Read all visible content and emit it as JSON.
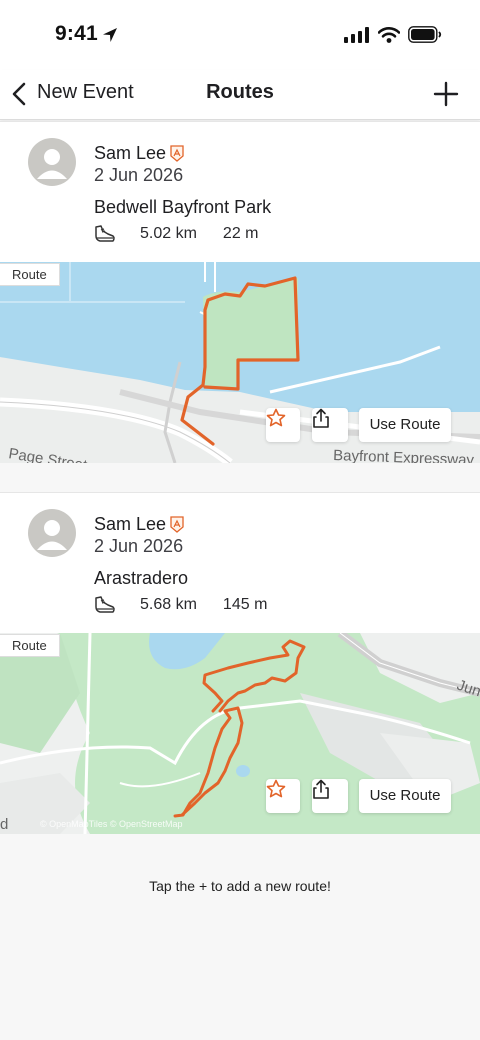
{
  "status_bar": {
    "time": "9:41"
  },
  "nav": {
    "back_label": "New Event",
    "title": "Routes"
  },
  "routes": [
    {
      "athlete": "Sam Lee",
      "date": "2 Jun 2026",
      "name": "Bedwell Bayfront Park",
      "distance": "5.02 km",
      "elevation": "22 m",
      "tag": "Route",
      "use_label": "Use Route",
      "map_labels": [
        "Page Street",
        "Bayfront Expressway"
      ],
      "attribution": ""
    },
    {
      "athlete": "Sam Lee",
      "date": "2 Jun 2026",
      "name": "Arastradero",
      "distance": "5.68 km",
      "elevation": "145 m",
      "tag": "Route",
      "use_label": "Use Route",
      "map_labels": [
        "Jun",
        "d"
      ],
      "attribution": "© OpenMapTiles © OpenStreetMap"
    }
  ],
  "footer_hint": "Tap the + to add a new route!",
  "colors": {
    "accent": "#e2642a",
    "water": "#aad8ef",
    "park": "#bfe5c1",
    "land": "#eef0ef",
    "avatar": "#c9c8c4"
  },
  "icons": [
    "location-arrow-icon",
    "signal-icon",
    "wifi-icon",
    "battery-icon",
    "chevron-left-icon",
    "plus-icon",
    "shoe-icon",
    "badge-icon",
    "star-icon",
    "share-icon"
  ]
}
